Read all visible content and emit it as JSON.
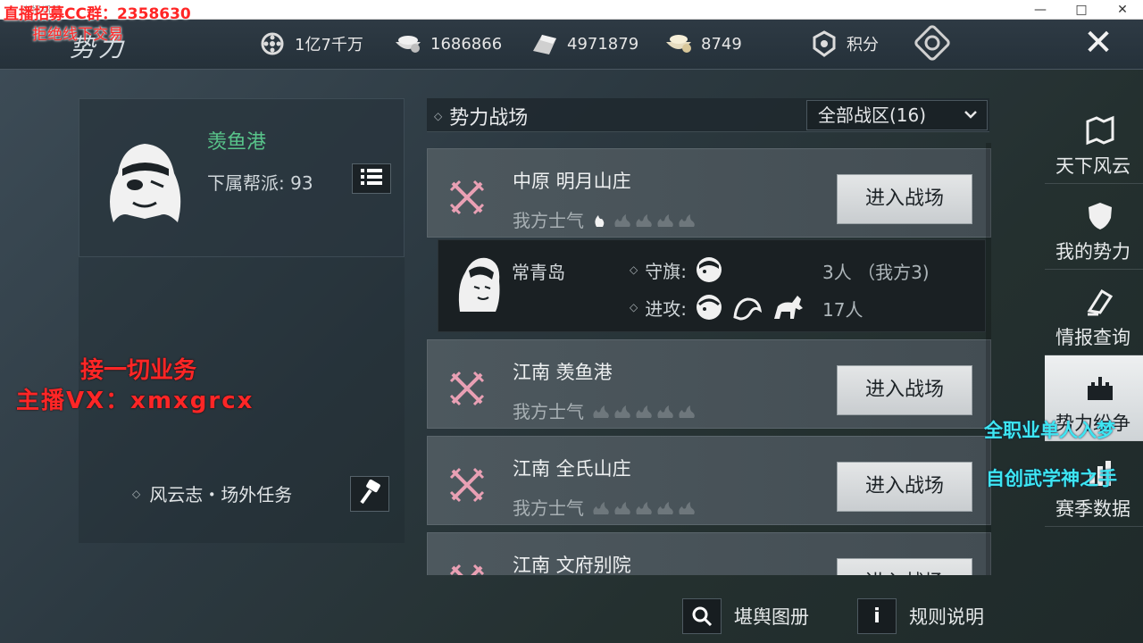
{
  "window": {
    "close_label": "✕",
    "max_label": "□",
    "min_label": "—",
    "title": "直播招募"
  },
  "header": {
    "title": "势力",
    "resources": [
      {
        "icon": "film-reel-icon",
        "value": "1亿7千万"
      },
      {
        "icon": "coin-bowl-icon",
        "value": "1686866"
      },
      {
        "icon": "silver-ingot-icon",
        "value": "4971879"
      },
      {
        "icon": "gold-bowl-icon",
        "value": "8749"
      }
    ],
    "points_label": "积分",
    "close_label": "✕"
  },
  "faction": {
    "name": "羡鱼港",
    "subordinate_label": "下属帮派: 93"
  },
  "side_task": {
    "label": "风云志・场外任务"
  },
  "battlefield": {
    "title": "势力战场",
    "zone_select": "全部战区(16)",
    "morale_label": "我方士气",
    "enter_label": "进入战场",
    "rows": [
      {
        "name": "中原 明月山庄",
        "morale": 1
      },
      {
        "name": "江南 羡鱼港",
        "morale": 0
      },
      {
        "name": "江南 全氏山庄",
        "morale": 0
      },
      {
        "name": "江南 文府别院",
        "morale": 0
      }
    ],
    "detail": {
      "island": "常青岛",
      "defend_label": "守旗:",
      "defend_count": "3人 （我方3)",
      "attack_label": "进攻:",
      "attack_count": "17人"
    }
  },
  "right_nav": [
    {
      "label": "天下风云",
      "icon": "map-scroll-icon",
      "active": false
    },
    {
      "label": "我的势力",
      "icon": "shield-icon",
      "active": false
    },
    {
      "label": "情报查询",
      "icon": "quill-icon",
      "active": false
    },
    {
      "label": "势力纷争",
      "icon": "castle-icon",
      "active": true
    },
    {
      "label": "赛季数据",
      "icon": "chart-icon",
      "active": false
    }
  ],
  "bottom": {
    "atlas_label": "堪舆图册",
    "rules_label": "规则说明",
    "rules_icon_glyph": "i"
  },
  "overlays": {
    "recruit": "直播招募CC群：2358630",
    "no_offline": "拒绝线下交易",
    "business": "接一切业务",
    "vx": "主播VX：xmxgrcx",
    "promo1": "全职业单人入梦",
    "promo2": "自创武学神之手"
  },
  "colors": {
    "faction_green": "#58c48a",
    "sword_pink": "#e9a0b4",
    "overlay_red": "#ff2626",
    "overlay_cyan": "#3ee6f2"
  }
}
